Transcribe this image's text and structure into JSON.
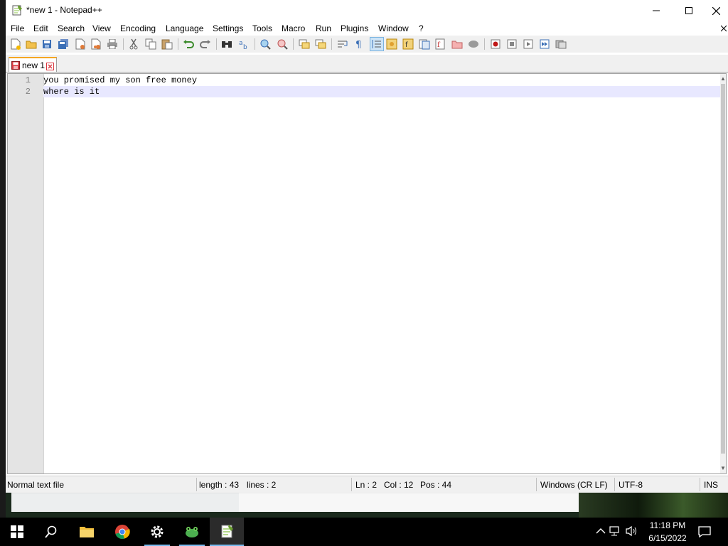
{
  "window": {
    "title": "*new 1 - Notepad++"
  },
  "menu": {
    "items": [
      "File",
      "Edit",
      "Search",
      "View",
      "Encoding",
      "Language",
      "Settings",
      "Tools",
      "Macro",
      "Run",
      "Plugins",
      "Window",
      "?"
    ]
  },
  "tab": {
    "label": "new 1"
  },
  "editor": {
    "lines": [
      {
        "number": "1",
        "text": "you promised my son free money"
      },
      {
        "number": "2",
        "text": "where is it"
      }
    ]
  },
  "status": {
    "filetype": "Normal text file",
    "length": "length : 43",
    "lines": "lines : 2",
    "ln": "Ln : 2",
    "col": "Col : 12",
    "pos": "Pos : 44",
    "eol": "Windows (CR LF)",
    "encoding": "UTF-8",
    "mode": "INS"
  },
  "taskbar": {
    "time": "11:18 PM",
    "date": "6/15/2022"
  },
  "colors": {
    "accent": "#f5a623",
    "current_line": "#e8e8ff",
    "taskbar_active": "#76b9ed"
  }
}
